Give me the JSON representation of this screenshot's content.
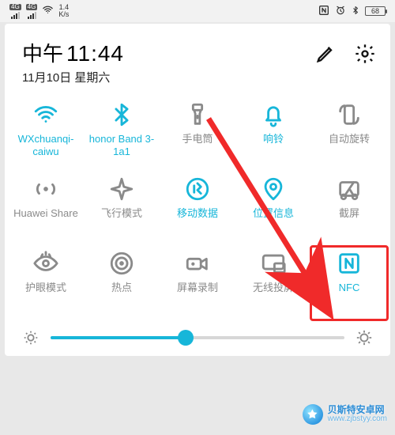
{
  "status": {
    "sim1_tag": "4G",
    "sim2_tag": "4G",
    "net_rate_top": "1.4",
    "net_rate_bot": "K/s",
    "battery": "68"
  },
  "header": {
    "ampm": "中午",
    "time": "11:44",
    "date": "11月10日 星期六"
  },
  "tiles": [
    {
      "id": "wifi",
      "label": "WXchuanqi-caiwu",
      "on": true
    },
    {
      "id": "bluetooth",
      "label": "honor Band 3-1a1",
      "on": true
    },
    {
      "id": "flashlight",
      "label": "手电筒",
      "on": false
    },
    {
      "id": "ringer",
      "label": "响铃",
      "on": true
    },
    {
      "id": "auto-rotate",
      "label": "自动旋转",
      "on": false
    },
    {
      "id": "huawei-share",
      "label": "Huawei Share",
      "on": false
    },
    {
      "id": "airplane",
      "label": "飞行模式",
      "on": false
    },
    {
      "id": "mobile-data",
      "label": "移动数据",
      "on": true
    },
    {
      "id": "location",
      "label": "位置信息",
      "on": true
    },
    {
      "id": "screenshot",
      "label": "截屏",
      "on": false
    },
    {
      "id": "eye-comfort",
      "label": "护眼模式",
      "on": false
    },
    {
      "id": "hotspot",
      "label": "热点",
      "on": false
    },
    {
      "id": "screen-rec",
      "label": "屏幕录制",
      "on": false
    },
    {
      "id": "cast",
      "label": "无线投屏",
      "on": false
    },
    {
      "id": "nfc",
      "label": "NFC",
      "on": true,
      "highlight": true
    }
  ],
  "brightness": {
    "value": 46
  },
  "watermark": {
    "line1": "贝斯特安卓网",
    "line2": "www.zjbstyy.com"
  }
}
